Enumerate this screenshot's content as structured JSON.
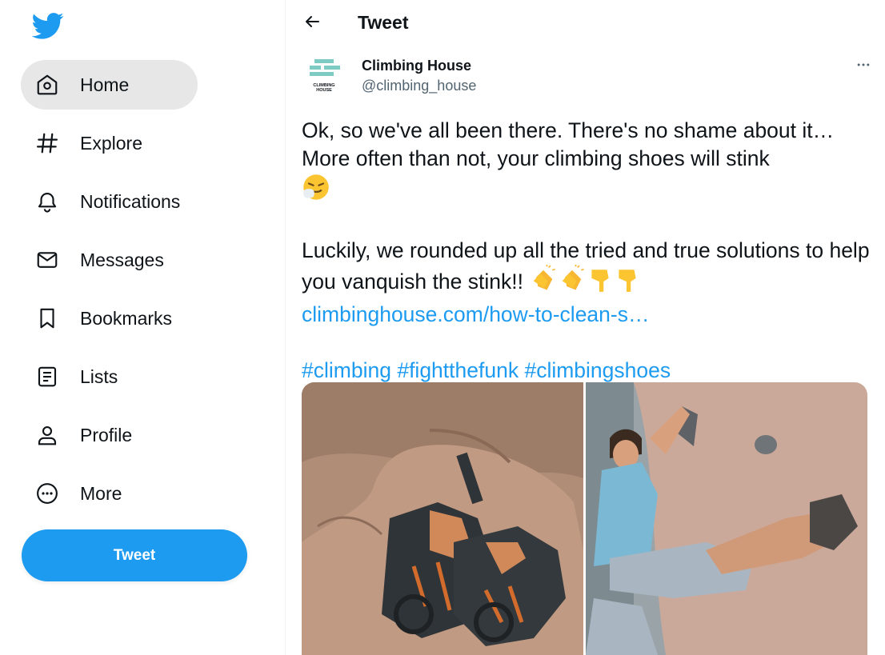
{
  "sidebar": {
    "logo_icon": "twitter-bird-icon",
    "items": [
      {
        "label": "Home",
        "icon": "home-icon",
        "active": true
      },
      {
        "label": "Explore",
        "icon": "hashtag-icon"
      },
      {
        "label": "Notifications",
        "icon": "bell-icon"
      },
      {
        "label": "Messages",
        "icon": "envelope-icon"
      },
      {
        "label": "Bookmarks",
        "icon": "bookmark-icon"
      },
      {
        "label": "Lists",
        "icon": "list-icon"
      },
      {
        "label": "Profile",
        "icon": "person-icon"
      },
      {
        "label": "More",
        "icon": "more-circle-icon"
      }
    ],
    "tweet_button": "Tweet"
  },
  "header": {
    "title": "Tweet",
    "back_icon": "arrow-left-icon"
  },
  "tweet": {
    "author": {
      "name": "Climbing House",
      "handle": "@climbing_house",
      "avatar_text": "CLIMBING HOUSE"
    },
    "text_line1": "Ok, so we've all been there. There's no shame about it… More often than not, your climbing shoes will stink",
    "text_line2": "Luckily, we rounded up all the tried and true solutions to help you vanquish the stink!!",
    "link": "climbinghouse.com/how-to-clean-s…",
    "hashtags": [
      "#climbing",
      "#fightthefunk",
      "#climbingshoes"
    ],
    "emojis": [
      "sneezing-face-emoji",
      "clapping-hands-emoji",
      "clapping-hands-emoji",
      "pointing-down-emoji",
      "pointing-down-emoji"
    ],
    "media": [
      {
        "alt": "climbing shoes on rock",
        "icon": "photo-climbing-shoes"
      },
      {
        "alt": "woman climbing wall",
        "icon": "photo-climber"
      }
    ]
  },
  "colors": {
    "accent": "#1d9bf0",
    "text": "#0f1419",
    "secondary": "#536471",
    "active_bg": "#e7e7e8"
  }
}
